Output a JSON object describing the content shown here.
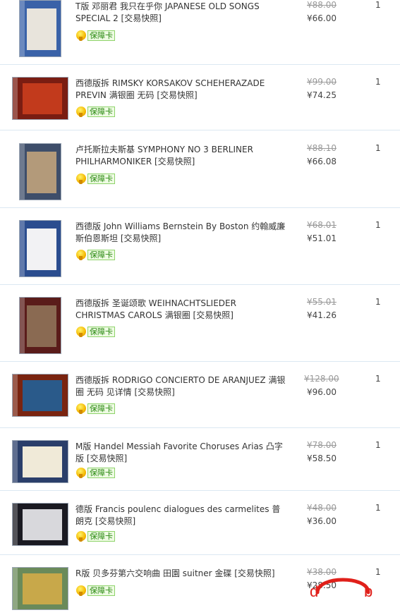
{
  "badge_label": "保障卡",
  "items": [
    {
      "title": "T版 邓丽君 我只在乎你 JAPANESE OLD SONGS SPECIAL 2 [交易快照]",
      "old_price": "¥88.00",
      "price": "¥66.00",
      "qty": "1",
      "case_color": "#3a62a8",
      "art_color": "#e8e4dc"
    },
    {
      "title": "西德版拆 RIMSKY KORSAKOV SCHEHERAZADE PREVIN 满银圈 无码 [交易快照]",
      "old_price": "¥99.00",
      "price": "¥74.25",
      "qty": "1",
      "case_color": "#7a1d12",
      "art_color": "#c23a1c"
    },
    {
      "title": "卢托斯拉夫斯基 SYMPHONY NO 3 BERLINER PHILHARMONIKER [交易快照]",
      "old_price": "¥88.10",
      "price": "¥66.08",
      "qty": "1",
      "case_color": "#3e4e6a",
      "art_color": "#b39a7a"
    },
    {
      "title": "西德版 John Williams Bernstein By Boston 约翰威廉斯伯恩斯坦 [交易快照]",
      "old_price": "¥68.01",
      "price": "¥51.01",
      "qty": "1",
      "case_color": "#2b4d8f",
      "art_color": "#f2f2f4"
    },
    {
      "title": "西德版拆 圣诞颂歌 WEIHNACHTSLIEDER CHRISTMAS CAROLS 满银圈 [交易快照]",
      "old_price": "¥55.01",
      "price": "¥41.26",
      "qty": "1",
      "case_color": "#5a1c1a",
      "art_color": "#8a6a52"
    },
    {
      "title": "西德版拆 RODRIGO CONCIERTO DE ARANJUEZ 满银圈 无码 见详情 [交易快照]",
      "old_price": "¥128.00",
      "price": "¥96.00",
      "qty": "1",
      "case_color": "#7a2410",
      "art_color": "#2a5a8a"
    },
    {
      "title": "M版 Handel Messiah Favorite Choruses Arias 凸字版 [交易快照]",
      "old_price": "¥78.00",
      "price": "¥58.50",
      "qty": "1",
      "case_color": "#2a3e6a",
      "art_color": "#f0ead8"
    },
    {
      "title": "德版 Francis poulenc dialogues des carmelites 普朗克 [交易快照]",
      "old_price": "¥48.00",
      "price": "¥36.00",
      "qty": "1",
      "case_color": "#1a1a22",
      "art_color": "#d8d8dc"
    },
    {
      "title": "R版 贝多芬第六交响曲 田園 suitner 金碟 [交易快照]",
      "old_price": "¥38.00",
      "price": "¥28.50",
      "qty": "1",
      "case_color": "#6a8a5a",
      "art_color": "#c8a84a"
    }
  ],
  "watermark": {
    "left_letter": "d",
    "right_letter": "b",
    "color": "#e0201a"
  }
}
